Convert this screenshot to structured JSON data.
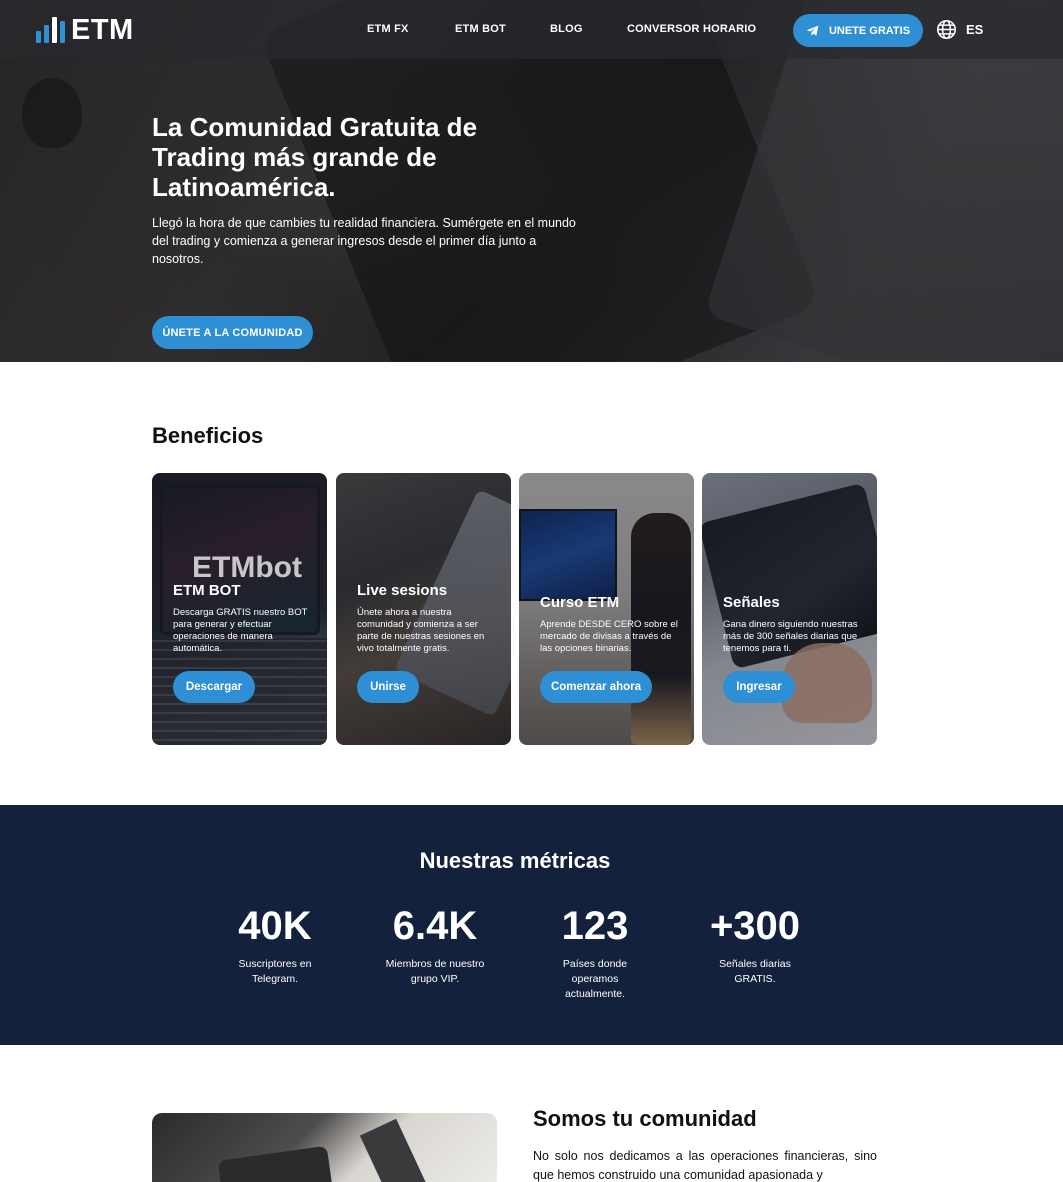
{
  "brand": {
    "logo_text": "ETM",
    "accent_color": "#2e8fd4",
    "dark_navy": "#14213d"
  },
  "nav": {
    "links": [
      "ETM FX",
      "ETM BOT",
      "BLOG",
      "CONVERSOR HORARIO"
    ],
    "join_label": "UNETE GRATIS",
    "join_icon": "telegram-icon",
    "language_icon": "globe-icon",
    "language": "ES"
  },
  "hero": {
    "title": "La Comunidad Gratuita de Trading más grande de Latinoamérica.",
    "subtitle": "Llegó la hora de que cambies tu realidad financiera. Sumérgete en el mundo del trading y comienza a generar ingresos desde el primer día junto a nosotros.",
    "cta_label": "ÚNETE A LA COMUNIDAD"
  },
  "benefits": {
    "title": "Beneficios",
    "cards": [
      {
        "title": "ETM BOT",
        "text": "Descarga GRATIS nuestro BOT para generar y efectuar operaciones de manera automática.",
        "button": "Descargar",
        "image_text": "ETMbot"
      },
      {
        "title": "Live sesions",
        "text": "Únete ahora a nuestra comunidad y comienza a ser parte de nuestras sesiones en vivo totalmente gratis.",
        "button": "Unirse"
      },
      {
        "title": "Curso ETM",
        "text": "Aprende DESDE CERO sobre el mercado de divisas a través de las opciones binarias.",
        "button": "Comenzar ahora"
      },
      {
        "title": "Señales",
        "text": "Gana dinero siguiendo nuestras más de 300 señales diarias que tenemos para ti.",
        "button": "Ingresar"
      }
    ]
  },
  "metrics": {
    "title": "Nuestras métricas",
    "items": [
      {
        "value": "40K",
        "label": "Suscriptores en Telegram."
      },
      {
        "value": "6.4K",
        "label": "Miembros de nuestro grupo VIP."
      },
      {
        "value": "123",
        "label": "Países donde operamos actualmente."
      },
      {
        "value": "+300",
        "label": "Señales diarias GRATIS."
      }
    ]
  },
  "community": {
    "title": "Somos tu comunidad",
    "text": "No solo nos dedicamos a las operaciones financieras, sino que hemos construido una comunidad apasionada y"
  }
}
